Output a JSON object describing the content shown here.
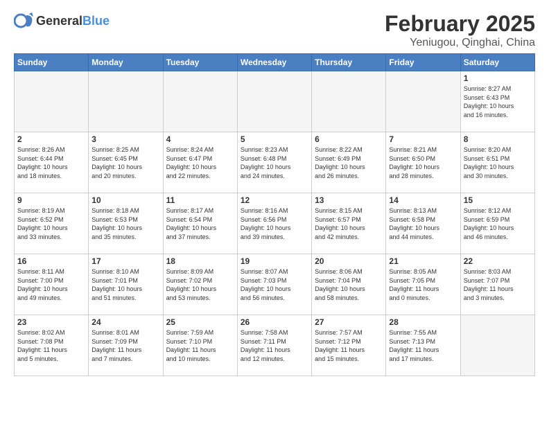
{
  "header": {
    "logo_general": "General",
    "logo_blue": "Blue",
    "month_title": "February 2025",
    "location": "Yeniugou, Qinghai, China"
  },
  "weekdays": [
    "Sunday",
    "Monday",
    "Tuesday",
    "Wednesday",
    "Thursday",
    "Friday",
    "Saturday"
  ],
  "weeks": [
    [
      {
        "day": "",
        "info": ""
      },
      {
        "day": "",
        "info": ""
      },
      {
        "day": "",
        "info": ""
      },
      {
        "day": "",
        "info": ""
      },
      {
        "day": "",
        "info": ""
      },
      {
        "day": "",
        "info": ""
      },
      {
        "day": "1",
        "info": "Sunrise: 8:27 AM\nSunset: 6:43 PM\nDaylight: 10 hours\nand 16 minutes."
      }
    ],
    [
      {
        "day": "2",
        "info": "Sunrise: 8:26 AM\nSunset: 6:44 PM\nDaylight: 10 hours\nand 18 minutes."
      },
      {
        "day": "3",
        "info": "Sunrise: 8:25 AM\nSunset: 6:45 PM\nDaylight: 10 hours\nand 20 minutes."
      },
      {
        "day": "4",
        "info": "Sunrise: 8:24 AM\nSunset: 6:47 PM\nDaylight: 10 hours\nand 22 minutes."
      },
      {
        "day": "5",
        "info": "Sunrise: 8:23 AM\nSunset: 6:48 PM\nDaylight: 10 hours\nand 24 minutes."
      },
      {
        "day": "6",
        "info": "Sunrise: 8:22 AM\nSunset: 6:49 PM\nDaylight: 10 hours\nand 26 minutes."
      },
      {
        "day": "7",
        "info": "Sunrise: 8:21 AM\nSunset: 6:50 PM\nDaylight: 10 hours\nand 28 minutes."
      },
      {
        "day": "8",
        "info": "Sunrise: 8:20 AM\nSunset: 6:51 PM\nDaylight: 10 hours\nand 30 minutes."
      }
    ],
    [
      {
        "day": "9",
        "info": "Sunrise: 8:19 AM\nSunset: 6:52 PM\nDaylight: 10 hours\nand 33 minutes."
      },
      {
        "day": "10",
        "info": "Sunrise: 8:18 AM\nSunset: 6:53 PM\nDaylight: 10 hours\nand 35 minutes."
      },
      {
        "day": "11",
        "info": "Sunrise: 8:17 AM\nSunset: 6:54 PM\nDaylight: 10 hours\nand 37 minutes."
      },
      {
        "day": "12",
        "info": "Sunrise: 8:16 AM\nSunset: 6:56 PM\nDaylight: 10 hours\nand 39 minutes."
      },
      {
        "day": "13",
        "info": "Sunrise: 8:15 AM\nSunset: 6:57 PM\nDaylight: 10 hours\nand 42 minutes."
      },
      {
        "day": "14",
        "info": "Sunrise: 8:13 AM\nSunset: 6:58 PM\nDaylight: 10 hours\nand 44 minutes."
      },
      {
        "day": "15",
        "info": "Sunrise: 8:12 AM\nSunset: 6:59 PM\nDaylight: 10 hours\nand 46 minutes."
      }
    ],
    [
      {
        "day": "16",
        "info": "Sunrise: 8:11 AM\nSunset: 7:00 PM\nDaylight: 10 hours\nand 49 minutes."
      },
      {
        "day": "17",
        "info": "Sunrise: 8:10 AM\nSunset: 7:01 PM\nDaylight: 10 hours\nand 51 minutes."
      },
      {
        "day": "18",
        "info": "Sunrise: 8:09 AM\nSunset: 7:02 PM\nDaylight: 10 hours\nand 53 minutes."
      },
      {
        "day": "19",
        "info": "Sunrise: 8:07 AM\nSunset: 7:03 PM\nDaylight: 10 hours\nand 56 minutes."
      },
      {
        "day": "20",
        "info": "Sunrise: 8:06 AM\nSunset: 7:04 PM\nDaylight: 10 hours\nand 58 minutes."
      },
      {
        "day": "21",
        "info": "Sunrise: 8:05 AM\nSunset: 7:05 PM\nDaylight: 11 hours\nand 0 minutes."
      },
      {
        "day": "22",
        "info": "Sunrise: 8:03 AM\nSunset: 7:07 PM\nDaylight: 11 hours\nand 3 minutes."
      }
    ],
    [
      {
        "day": "23",
        "info": "Sunrise: 8:02 AM\nSunset: 7:08 PM\nDaylight: 11 hours\nand 5 minutes."
      },
      {
        "day": "24",
        "info": "Sunrise: 8:01 AM\nSunset: 7:09 PM\nDaylight: 11 hours\nand 7 minutes."
      },
      {
        "day": "25",
        "info": "Sunrise: 7:59 AM\nSunset: 7:10 PM\nDaylight: 11 hours\nand 10 minutes."
      },
      {
        "day": "26",
        "info": "Sunrise: 7:58 AM\nSunset: 7:11 PM\nDaylight: 11 hours\nand 12 minutes."
      },
      {
        "day": "27",
        "info": "Sunrise: 7:57 AM\nSunset: 7:12 PM\nDaylight: 11 hours\nand 15 minutes."
      },
      {
        "day": "28",
        "info": "Sunrise: 7:55 AM\nSunset: 7:13 PM\nDaylight: 11 hours\nand 17 minutes."
      },
      {
        "day": "",
        "info": ""
      }
    ]
  ]
}
